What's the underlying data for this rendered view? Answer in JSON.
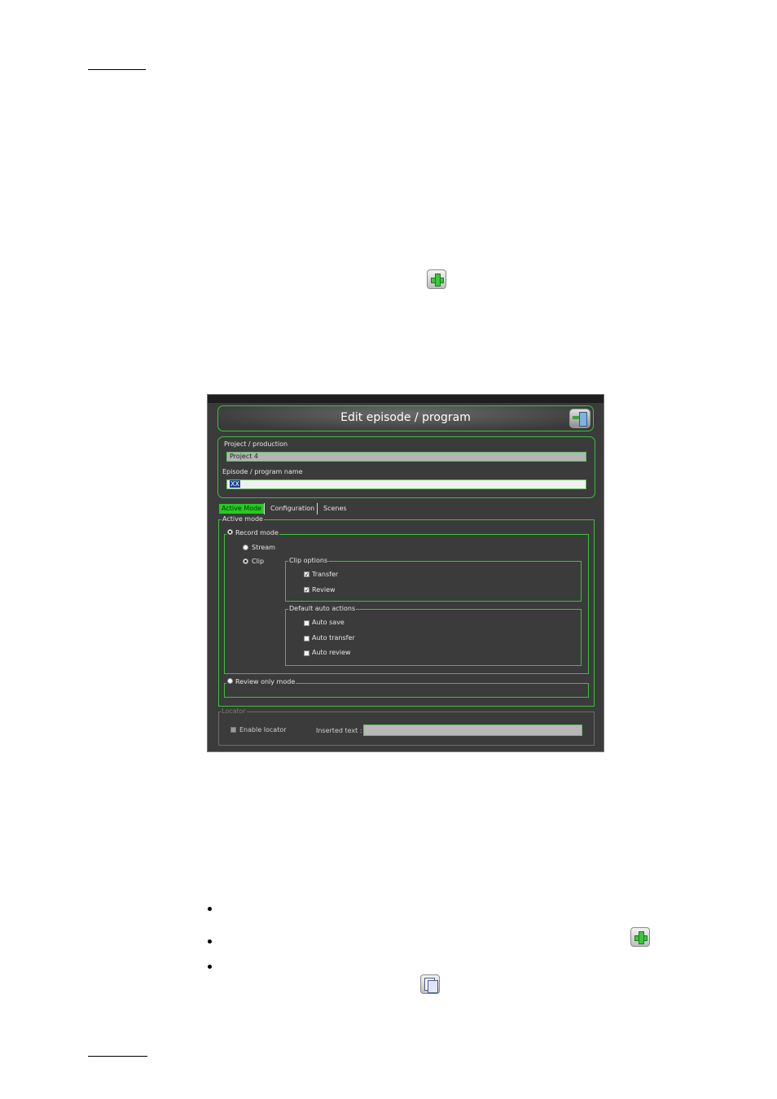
{
  "dialog": {
    "title": "Edit episode / program",
    "project_label": "Project / production",
    "project_value": "Project 4",
    "episode_label": "Episode / program name",
    "episode_value": "XX",
    "tabs": [
      "Active Mode",
      "Configuration",
      "Scenes"
    ],
    "active_mode_group": "Active mode",
    "record_mode": "Record mode",
    "stream": "Stream",
    "clip": "Clip",
    "clip_options": "Clip options",
    "transfer": "Transfer",
    "review": "Review",
    "default_auto_actions": "Default auto actions",
    "auto_save": "Auto save",
    "auto_transfer": "Auto transfer",
    "auto_review": "Auto review",
    "review_only_mode": "Review only mode",
    "locator_group": "Locator",
    "enable_locator": "Enable locator",
    "inserted_text_label": "Inserted text :",
    "checkmark": "✓"
  },
  "icons": {
    "top_add": "plus-icon",
    "bullet_add": "plus-icon",
    "bullet_copy": "copy-icon",
    "exit": "exit-icon"
  },
  "colors": {
    "accent_green": "#39c239",
    "active_tab": "#22cc22",
    "dialog_bg": "#3b3b3b"
  }
}
